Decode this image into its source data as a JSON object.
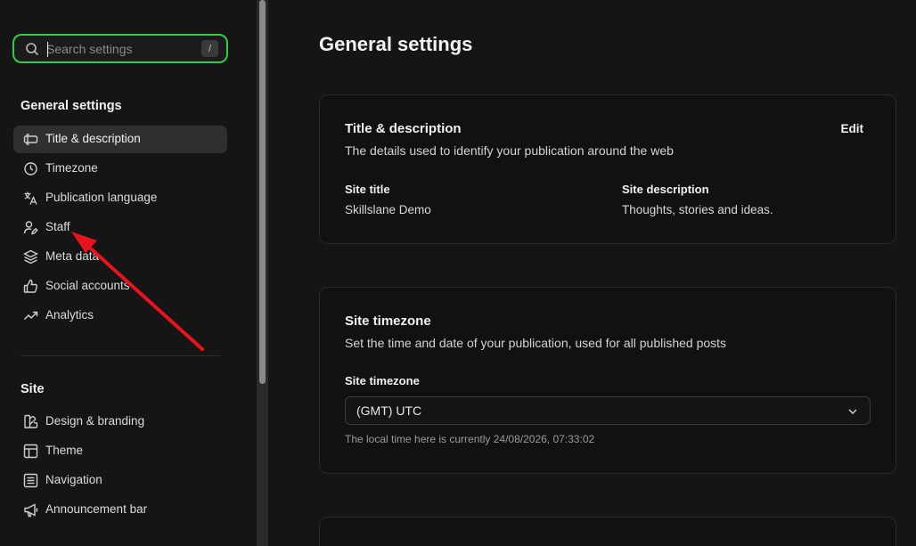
{
  "sidebar": {
    "search": {
      "placeholder": "Search settings",
      "shortcut": "/"
    },
    "sections": [
      {
        "title": "General settings",
        "items": [
          {
            "label": "Title & description",
            "icon": "title-description-icon",
            "active": true
          },
          {
            "label": "Timezone",
            "icon": "clock-icon"
          },
          {
            "label": "Publication language",
            "icon": "translate-icon"
          },
          {
            "label": "Staff",
            "icon": "user-edit-icon"
          },
          {
            "label": "Meta data",
            "icon": "layers-icon"
          },
          {
            "label": "Social accounts",
            "icon": "thumbs-up-icon"
          },
          {
            "label": "Analytics",
            "icon": "trend-up-icon"
          }
        ]
      },
      {
        "title": "Site",
        "items": [
          {
            "label": "Design & branding",
            "icon": "brush-icon"
          },
          {
            "label": "Theme",
            "icon": "layout-icon"
          },
          {
            "label": "Navigation",
            "icon": "list-icon"
          },
          {
            "label": "Announcement bar",
            "icon": "megaphone-icon"
          }
        ]
      }
    ]
  },
  "main": {
    "page_title": "General settings",
    "title_card": {
      "title": "Title & description",
      "description": "The details used to identify your publication around the web",
      "edit_label": "Edit",
      "site_title_label": "Site title",
      "site_title_value": "Skillslane Demo",
      "site_description_label": "Site description",
      "site_description_value": "Thoughts, stories and ideas."
    },
    "timezone_card": {
      "title": "Site timezone",
      "description": "Set the time and date of your publication, used for all published posts",
      "field_label": "Site timezone",
      "selected_value": "(GMT) UTC",
      "hint": "The local time here is currently 24/08/2026, 07:33:02"
    }
  },
  "colors": {
    "accent_focus": "#30cf43",
    "annotation_arrow": "#e8141b",
    "background": "#151515",
    "card_background": "#111111"
  }
}
